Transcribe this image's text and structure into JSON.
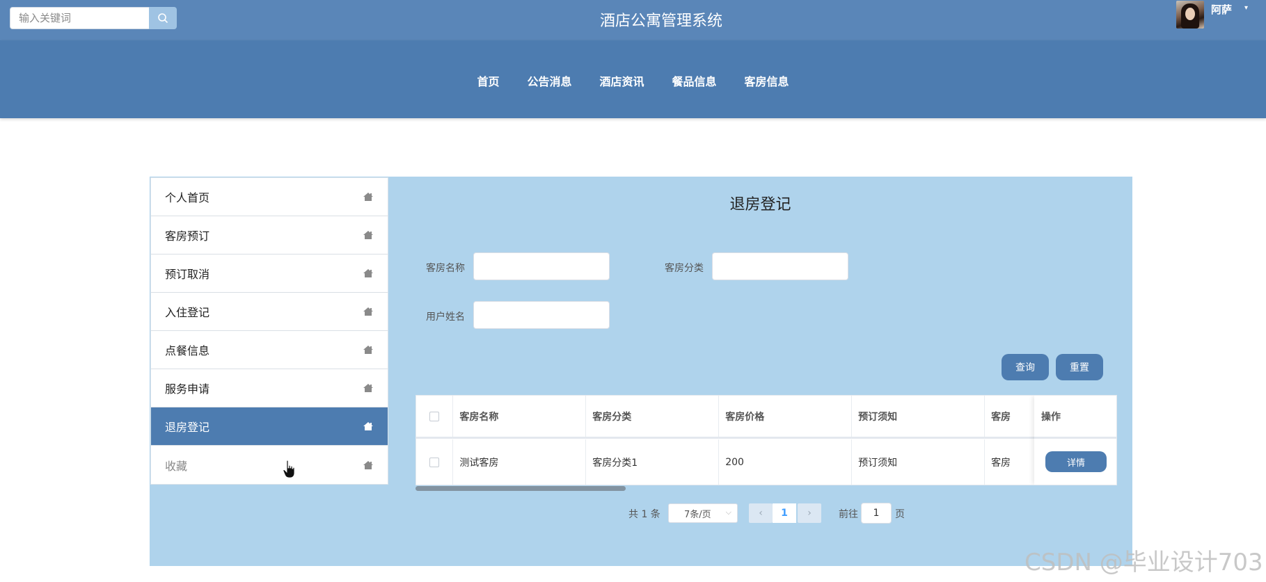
{
  "header": {
    "search_placeholder": "输入关键词",
    "site_title": "酒店公寓管理系统",
    "user_name": "阿萨",
    "user_caret": "▾"
  },
  "nav": {
    "items": [
      {
        "label": "首页"
      },
      {
        "label": "公告消息"
      },
      {
        "label": "酒店资讯"
      },
      {
        "label": "餐品信息"
      },
      {
        "label": "客房信息"
      }
    ]
  },
  "sidebar": {
    "items": [
      {
        "label": "个人首页"
      },
      {
        "label": "客房预订"
      },
      {
        "label": "预订取消"
      },
      {
        "label": "入住登记"
      },
      {
        "label": "点餐信息"
      },
      {
        "label": "服务申请"
      },
      {
        "label": "退房登记",
        "active": true
      },
      {
        "label": "收藏"
      }
    ]
  },
  "page": {
    "title": "退房登记"
  },
  "filters": {
    "room_name_label": "客房名称",
    "room_category_label": "客房分类",
    "user_name_label": "用户姓名",
    "query_button": "查询",
    "reset_button": "重置"
  },
  "table": {
    "columns": [
      "客房名称",
      "客房分类",
      "客房价格",
      "预订须知",
      "客房"
    ],
    "op_header": "操作",
    "rows": [
      {
        "cells": [
          "测试客房",
          "客房分类1",
          "200",
          "预订须知",
          "客房"
        ],
        "action": "详情"
      }
    ]
  },
  "pagination": {
    "total": "共 1 条",
    "page_size": "7条/页",
    "current_page": "1",
    "goto_label": "前往",
    "goto_value": "1",
    "page_unit": "页"
  },
  "watermark": "CSDN @毕业设计703",
  "colors": {
    "topbar": "#5a86b8",
    "navband": "#4d7cb0",
    "panel": "#afd3ec",
    "accent": "#4d7cb0"
  }
}
